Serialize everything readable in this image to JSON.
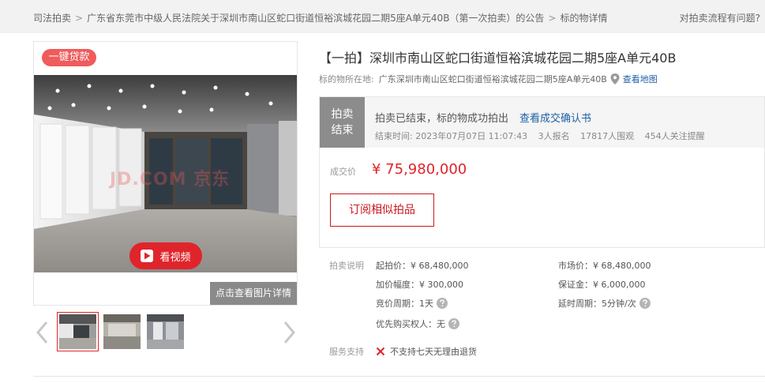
{
  "breadcrumb": {
    "items": [
      "司法拍卖",
      "广东省东莞市中级人民法院关于深圳市南山区蛇口街道恒裕滨城花园二期5座A单元40B（第一次拍卖）的公告",
      "标的物详情"
    ],
    "separator": ">",
    "help_link": "对拍卖流程有问题?"
  },
  "gallery": {
    "loan_badge": "一键贷款",
    "watermark": "JD.COM 京东",
    "video_button": "看视频",
    "more_pictures": "点击查看图片详情"
  },
  "listing": {
    "title": "【一拍】深圳市南山区蛇口街道恒裕滨城花园二期5座A单元40B",
    "location_label": "标的物所在地:",
    "location_address": "广东深圳市南山区蛇口街道恒裕滨城花园二期5座A单元40B",
    "map_link": "查看地图"
  },
  "status": {
    "tag_line1": "拍卖",
    "tag_line2": "结束",
    "message": "拍卖已结束，标的物成功拍出",
    "confirm_link": "查看成交确认书",
    "end_time": "结束时间:  2023年07月07日 11:07:43",
    "registered": "3人报名",
    "onlookers": "17817人围观",
    "followers": "454人关注提醒",
    "deal_label": "成交价",
    "deal_price": "¥ 75,980,000",
    "subscribe_button": "订阅相似拍品"
  },
  "auction_info": {
    "section_label": "拍卖说明",
    "starting_price": "起拍价：¥ 68,480,000",
    "market_price": "市场价：¥ 68,480,000",
    "increment": "加价幅度：¥ 300,000",
    "deposit": "保证金：¥ 6,000,000",
    "bidding_period": "竞价周期：1天",
    "extension_period": "延时周期：5分钟/次",
    "priority_buyer": "优先购买权人：无"
  },
  "service": {
    "section_label": "服务支持",
    "no_return": "不支持七天无理由退货"
  },
  "colors": {
    "accent_red": "#e0242b",
    "link_blue": "#1f5fa5",
    "badge_red": "#f05b5b",
    "status_gray": "#8c8c8c"
  }
}
